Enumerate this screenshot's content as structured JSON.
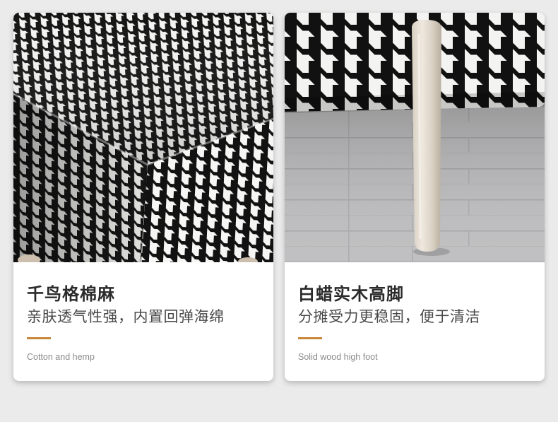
{
  "cards": [
    {
      "title": "千鸟格棉麻",
      "subtitle": "亲肤透气性强，内置回弹海绵",
      "caption": "Cotton and hemp"
    },
    {
      "title": "白蜡实木高脚",
      "subtitle": "分摊受力更稳固，便于清洁",
      "caption": "Solid wood high foot"
    }
  ],
  "colors": {
    "accent": "#c8873a",
    "background": "#ebebeb",
    "card": "#ffffff"
  }
}
